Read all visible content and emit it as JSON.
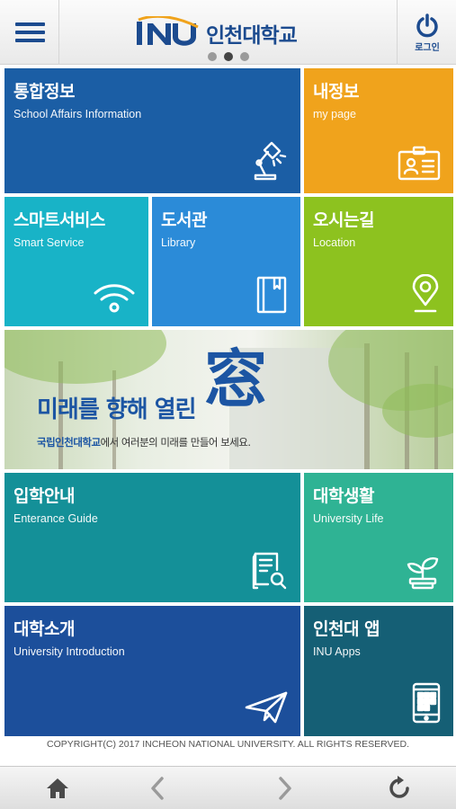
{
  "header": {
    "logo_text": "인천대학교",
    "login_label": "로그인",
    "page_indicator": {
      "pages": 3,
      "current": 2
    }
  },
  "tiles": {
    "school_affairs": {
      "title": "통합정보",
      "subtitle": "School Affairs Information",
      "icon": "lamp-icon",
      "color": "#1b5ea5"
    },
    "my_page": {
      "title": "내정보",
      "subtitle": "my page",
      "icon": "id-card-icon",
      "color": "#f0a31c"
    },
    "smart_service": {
      "title": "스마트서비스",
      "subtitle": "Smart Service",
      "icon": "wifi-icon",
      "color": "#18b3c7"
    },
    "library": {
      "title": "도서관",
      "subtitle": "Library",
      "icon": "book-icon",
      "color": "#2b8bd8"
    },
    "location": {
      "title": "오시는길",
      "subtitle": "Location",
      "icon": "map-pin-icon",
      "color": "#8dc21f"
    },
    "admission": {
      "title": "입학안내",
      "subtitle": "Enterance Guide",
      "icon": "document-search-icon",
      "color": "#149098"
    },
    "university_life": {
      "title": "대학생활",
      "subtitle": "University Life",
      "icon": "plant-icon",
      "color": "#2fb394"
    },
    "introduction": {
      "title": "대학소개",
      "subtitle": "University Introduction",
      "icon": "paper-plane-icon",
      "color": "#1c4f9b"
    },
    "apps": {
      "title": "인천대 앱",
      "subtitle": "INU Apps",
      "icon": "phone-apps-icon",
      "color": "#155f75"
    }
  },
  "banner": {
    "headline": "미래를 향해 열린",
    "character": "窓",
    "sub_highlight": "국립인천대학교",
    "sub_rest": "에서 여러분의 미래를 만들어 보세요."
  },
  "footer": {
    "copyright": "COPYRIGHT(C) 2017 INCHEON NATIONAL UNIVERSITY. ALL RIGHTS RESERVED."
  },
  "bottom_nav": [
    "home-icon",
    "back-arrow-icon",
    "forward-arrow-icon",
    "refresh-icon"
  ]
}
